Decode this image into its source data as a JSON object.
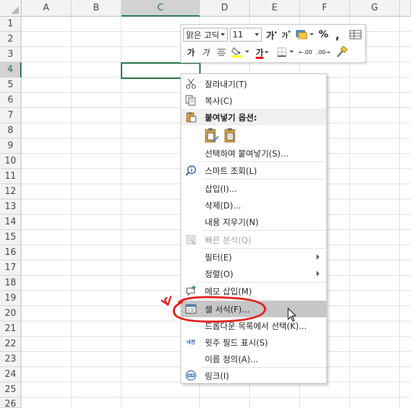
{
  "sheet": {
    "columns": [
      "A",
      "B",
      "C",
      "D",
      "E",
      "F",
      "G"
    ],
    "rows": [
      "1",
      "2",
      "3",
      "4",
      "5",
      "6",
      "7",
      "8",
      "9",
      "10",
      "11",
      "12",
      "13",
      "14",
      "15",
      "16",
      "17",
      "18",
      "19",
      "20",
      "21",
      "22",
      "23",
      "24",
      "25",
      "26"
    ],
    "selected_column": "C",
    "selected_row": "4",
    "accent_color": "#217346"
  },
  "mini_toolbar": {
    "font_name": "맑은 고딕",
    "font_size": "11",
    "grow_font": "가",
    "shrink_font": "가",
    "percent": "%",
    "comma": ",",
    "bold": "가",
    "italic": "가",
    "font_color_glyph": "가",
    "decrease_decimal": "←.00",
    "increase_decimal": ".00→",
    "fill_color": "#ffff00",
    "font_color": "#e00000"
  },
  "context_menu": {
    "cut": "잘라내기(T)",
    "copy": "복사(C)",
    "paste_options": "붙여넣기 옵션:",
    "paste_special": "선택하여 붙여넣기(S)...",
    "smart_lookup": "스마트 조회(L)",
    "insert": "삽입(I)...",
    "delete": "삭제(D)...",
    "clear_contents": "내용 지우기(N)",
    "quick_analysis": "빠른 분석(Q)",
    "filter": "필터(E)",
    "sort": "정렬(O)",
    "insert_comment": "메모 삽입(M)",
    "format_cells": "셀 서식(F)...",
    "pick_from_list": "드롭다운 목록에서 선택(K)...",
    "phonetic": "윗주 필드 표시(S)",
    "define_name": "이름 정의(A)...",
    "link": "링크(I)",
    "phonetic_icon_text": "내천",
    "annotation_color": "#e0201c"
  }
}
